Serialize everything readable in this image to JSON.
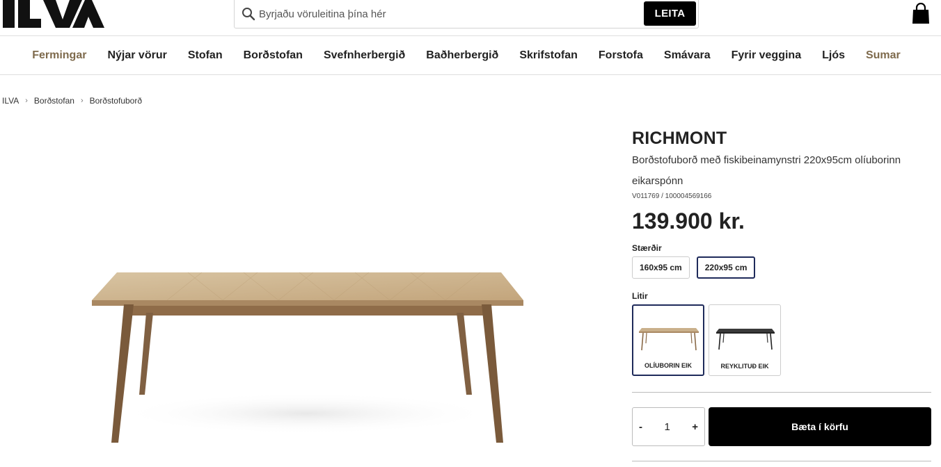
{
  "header": {
    "logo_text": "ILVA",
    "search_placeholder": "Byrjaðu vöruleitina þína hér",
    "search_button": "LEITA"
  },
  "nav": {
    "items": [
      {
        "label": "Fermingar",
        "accent": true
      },
      {
        "label": "Nýjar vörur"
      },
      {
        "label": "Stofan"
      },
      {
        "label": "Borðstofan"
      },
      {
        "label": "Svefnherbergið"
      },
      {
        "label": "Baðherbergið"
      },
      {
        "label": "Skrifstofan"
      },
      {
        "label": "Forstofa"
      },
      {
        "label": "Smávara"
      },
      {
        "label": "Fyrir veggina"
      },
      {
        "label": "Ljós"
      },
      {
        "label": "Sumar",
        "accent": true
      }
    ],
    "accent_color": "#7e6a4c"
  },
  "breadcrumb": [
    "ILVA",
    "Borðstofan",
    "Borðstofuborð"
  ],
  "product": {
    "name": "RICHMONT",
    "description": "Borðstofuborð með fiskibeinamynstri 220x95cm olíuborinn eikarspónn",
    "sku": "V011769 / 100004569166",
    "price": "139.900 kr.",
    "sizes_label": "Stærðir",
    "sizes": [
      "160x95 cm",
      "220x95 cm"
    ],
    "selected_size": "220x95 cm",
    "colors_label": "Litir",
    "colors": [
      "OLÍUBORIN EIK",
      "REYKLITUÐ EIK"
    ],
    "selected_color": "OLÍUBORIN EIK",
    "quantity": "1",
    "qty_minus": "-",
    "qty_plus": "+",
    "add_to_cart": "Bæta í körfu"
  },
  "colors": {
    "selection_border": "#1e2a5a",
    "oak": "#c9b08b",
    "leg": "#8a6a48"
  }
}
